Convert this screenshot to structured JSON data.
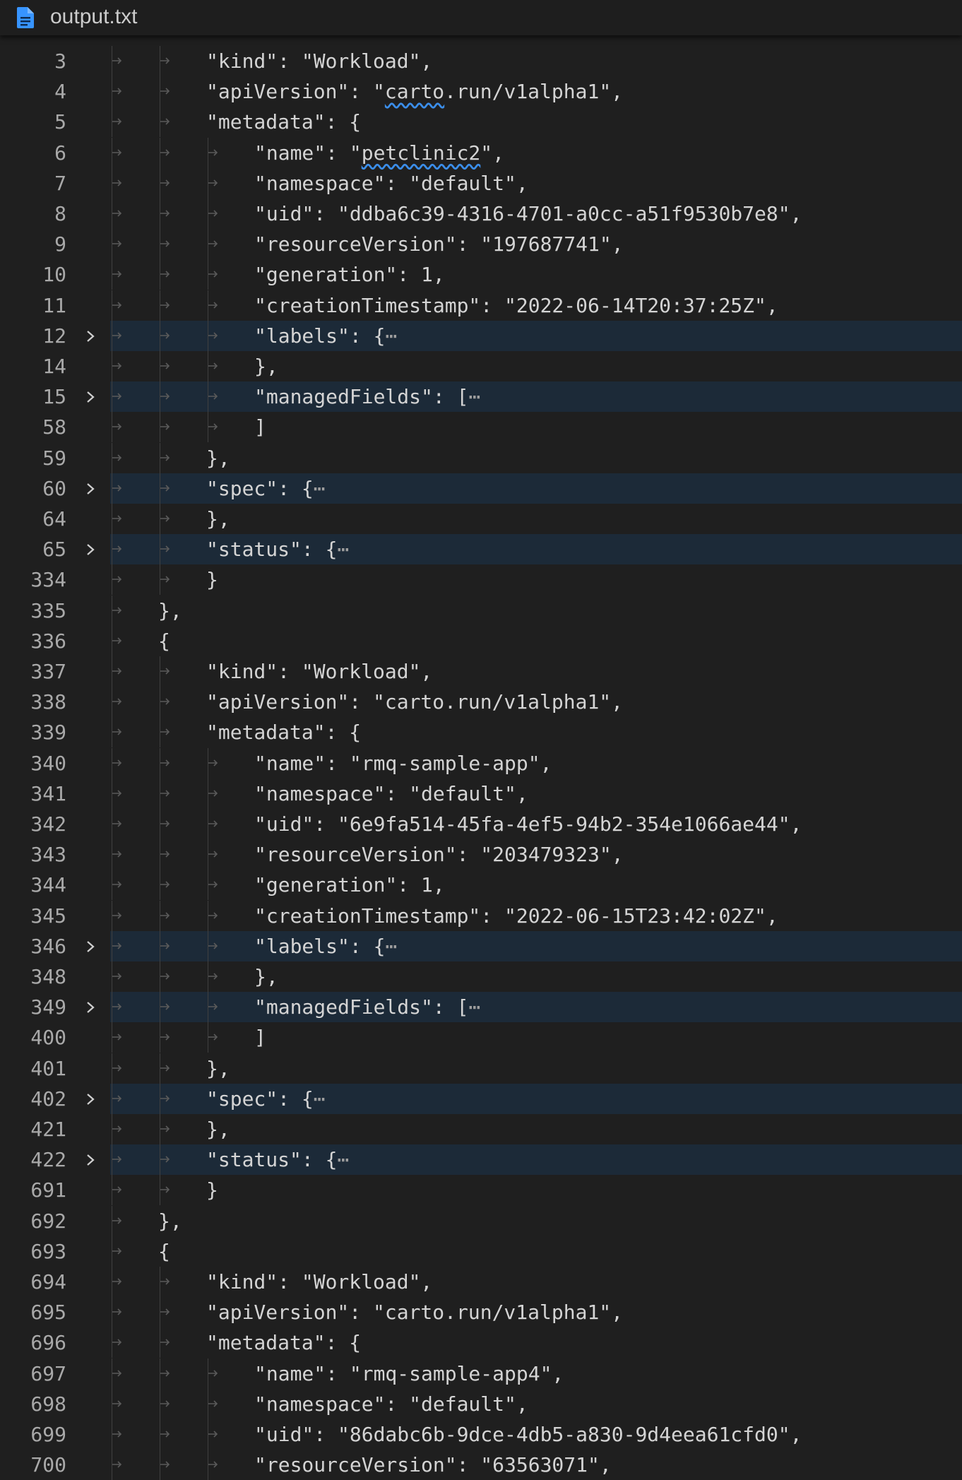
{
  "tab": {
    "title": "output.txt",
    "icon": "file-text-icon"
  },
  "lines": [
    {
      "n": "3",
      "depth": 2,
      "text": "\"kind\": \"Workload\","
    },
    {
      "n": "4",
      "depth": 2,
      "text": "\"apiVersion\": \"carto.run/v1alpha1\",",
      "sq": "carto"
    },
    {
      "n": "5",
      "depth": 2,
      "text": "\"metadata\": {"
    },
    {
      "n": "6",
      "depth": 3,
      "text": "\"name\": \"petclinic2\",",
      "sq": "petclinic2"
    },
    {
      "n": "7",
      "depth": 3,
      "text": "\"namespace\": \"default\","
    },
    {
      "n": "8",
      "depth": 3,
      "text": "\"uid\": \"ddba6c39-4316-4701-a0cc-a51f9530b7e8\","
    },
    {
      "n": "9",
      "depth": 3,
      "text": "\"resourceVersion\": \"197687741\","
    },
    {
      "n": "10",
      "depth": 3,
      "text": "\"generation\": 1,"
    },
    {
      "n": "11",
      "depth": 3,
      "text": "\"creationTimestamp\": \"2022-06-14T20:37:25Z\","
    },
    {
      "n": "12",
      "depth": 3,
      "text": "\"labels\": {",
      "folded": true
    },
    {
      "n": "14",
      "depth": 3,
      "text": "},"
    },
    {
      "n": "15",
      "depth": 3,
      "text": "\"managedFields\": [",
      "folded": true
    },
    {
      "n": "58",
      "depth": 3,
      "text": "]"
    },
    {
      "n": "59",
      "depth": 2,
      "text": "},"
    },
    {
      "n": "60",
      "depth": 2,
      "text": "\"spec\": {",
      "folded": true
    },
    {
      "n": "64",
      "depth": 2,
      "text": "},"
    },
    {
      "n": "65",
      "depth": 2,
      "text": "\"status\": {",
      "folded": true
    },
    {
      "n": "334",
      "depth": 2,
      "text": "}"
    },
    {
      "n": "335",
      "depth": 1,
      "text": "},"
    },
    {
      "n": "336",
      "depth": 1,
      "text": "{"
    },
    {
      "n": "337",
      "depth": 2,
      "text": "\"kind\": \"Workload\","
    },
    {
      "n": "338",
      "depth": 2,
      "text": "\"apiVersion\": \"carto.run/v1alpha1\","
    },
    {
      "n": "339",
      "depth": 2,
      "text": "\"metadata\": {"
    },
    {
      "n": "340",
      "depth": 3,
      "text": "\"name\": \"rmq-sample-app\","
    },
    {
      "n": "341",
      "depth": 3,
      "text": "\"namespace\": \"default\","
    },
    {
      "n": "342",
      "depth": 3,
      "text": "\"uid\": \"6e9fa514-45fa-4ef5-94b2-354e1066ae44\","
    },
    {
      "n": "343",
      "depth": 3,
      "text": "\"resourceVersion\": \"203479323\","
    },
    {
      "n": "344",
      "depth": 3,
      "text": "\"generation\": 1,"
    },
    {
      "n": "345",
      "depth": 3,
      "text": "\"creationTimestamp\": \"2022-06-15T23:42:02Z\","
    },
    {
      "n": "346",
      "depth": 3,
      "text": "\"labels\": {",
      "folded": true
    },
    {
      "n": "348",
      "depth": 3,
      "text": "},"
    },
    {
      "n": "349",
      "depth": 3,
      "text": "\"managedFields\": [",
      "folded": true
    },
    {
      "n": "400",
      "depth": 3,
      "text": "]"
    },
    {
      "n": "401",
      "depth": 2,
      "text": "},"
    },
    {
      "n": "402",
      "depth": 2,
      "text": "\"spec\": {",
      "folded": true
    },
    {
      "n": "421",
      "depth": 2,
      "text": "},"
    },
    {
      "n": "422",
      "depth": 2,
      "text": "\"status\": {",
      "folded": true
    },
    {
      "n": "691",
      "depth": 2,
      "text": "}"
    },
    {
      "n": "692",
      "depth": 1,
      "text": "},"
    },
    {
      "n": "693",
      "depth": 1,
      "text": "{"
    },
    {
      "n": "694",
      "depth": 2,
      "text": "\"kind\": \"Workload\","
    },
    {
      "n": "695",
      "depth": 2,
      "text": "\"apiVersion\": \"carto.run/v1alpha1\","
    },
    {
      "n": "696",
      "depth": 2,
      "text": "\"metadata\": {"
    },
    {
      "n": "697",
      "depth": 3,
      "text": "\"name\": \"rmq-sample-app4\","
    },
    {
      "n": "698",
      "depth": 3,
      "text": "\"namespace\": \"default\","
    },
    {
      "n": "699",
      "depth": 3,
      "text": "\"uid\": \"86dabc6b-9dce-4db5-a830-9d4eea61cfd0\","
    },
    {
      "n": "700",
      "depth": 3,
      "text": "\"resourceVersion\": \"63563071\","
    }
  ],
  "colors": {
    "background": "#1f1f1f",
    "text": "#d4d4d4",
    "line_number": "#a9a9a9",
    "folded_highlight": "#1c2a38",
    "squiggle": "#3b8eea"
  }
}
